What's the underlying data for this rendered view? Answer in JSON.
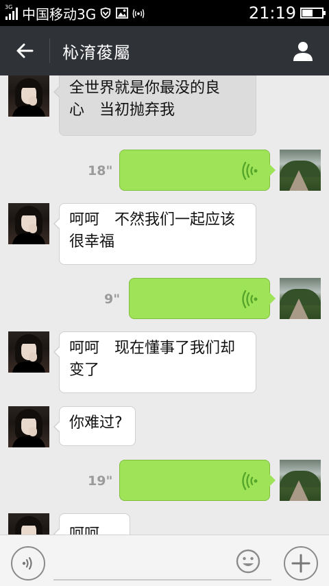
{
  "status_bar": {
    "network_tag": "3G",
    "carrier": "中国移动3G",
    "time": "21:19",
    "battery_level": 0.55,
    "icons": [
      "signal-icon",
      "shield-icon",
      "image-icon",
      "wireless-icon",
      "battery-icon"
    ]
  },
  "header": {
    "title": "杺淯葰屬",
    "back_icon": "arrow-left-icon",
    "profile_icon": "person-icon",
    "background": "#2f3237"
  },
  "messages": [
    {
      "side": "in",
      "text": "全世界就是你最没的良心　当初抛弃我",
      "line1": "全世界就是你最没的良",
      "line2": "心　当初抛弃我"
    },
    {
      "side": "out",
      "type": "voice",
      "duration": "18\""
    },
    {
      "side": "in",
      "line1": "呵呵　不然我们一起应该",
      "line2": "很幸福"
    },
    {
      "side": "out",
      "type": "voice",
      "duration": "9\""
    },
    {
      "side": "in",
      "line1": "呵呵　现在懂事了我们却",
      "line2": "变了"
    },
    {
      "side": "in",
      "line1": "你难过?"
    },
    {
      "side": "out",
      "type": "voice",
      "duration": "19\""
    },
    {
      "side": "in",
      "line1": "呵呵"
    }
  ],
  "input_bar": {
    "placeholder": "",
    "voice_icon": "voice-mode-icon",
    "emoji_icon": "smiley-icon",
    "plus_icon": "plus-icon"
  },
  "colors": {
    "voice_bubble": "#9fe358",
    "chat_background": "#ebebeb",
    "voice_accent": "#55a62a"
  }
}
